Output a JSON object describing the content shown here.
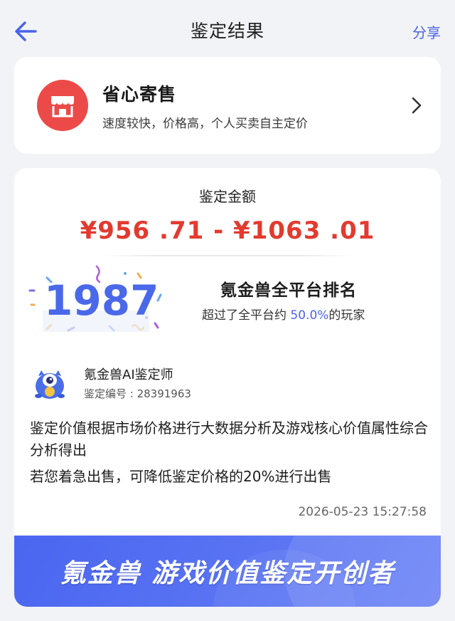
{
  "header": {
    "title": "鉴定结果",
    "share_label": "分享",
    "back_icon": "arrow-left-icon"
  },
  "consign": {
    "title": "省心寄售",
    "subtitle": "速度较快，价格高，个人买卖自主定价",
    "icon": "shop-icon"
  },
  "result": {
    "amount_label": "鉴定金额",
    "amount_range": "¥956 .71 - ¥1063 .01",
    "rank_number": "1987",
    "rank_title": "氪金兽全平台排名",
    "rank_desc_prefix": "超过了全平台约 ",
    "rank_percent": "50.0%",
    "rank_desc_suffix": "的玩家",
    "appraiser_name": "氪金兽AI鉴定师",
    "appraisal_id": "鉴定编号 : 28391963",
    "description_1": "鉴定价值根据市场价格进行大数据分析及游戏核心价值属性综合分析得出",
    "description_2": "若您着急出售，可降低鉴定价格的20%进行出售",
    "timestamp": "2026-05-23 15:27:58",
    "banner_text": "氪金兽 游戏价值鉴定开创者"
  },
  "colors": {
    "accent": "#4a63e8",
    "price_red": "#e33a2f",
    "shop_red": "#ec4a48",
    "background": "#f2f3f7"
  }
}
